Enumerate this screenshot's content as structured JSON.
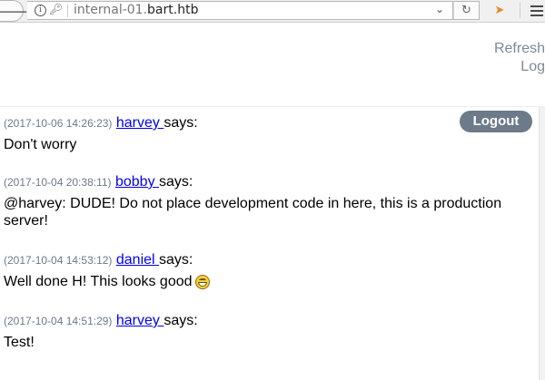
{
  "browser": {
    "back_icon": "arrow-left-icon",
    "info_icon": "info-icon",
    "key_icon": "key-icon",
    "url_host": "internal-01.",
    "url_domain": "bart.htb",
    "dropdown_icon": "chevron-down-icon",
    "reload_icon": "reload-icon",
    "extension_icon": "extension-icon",
    "menu_icon": "hamburger-menu-icon"
  },
  "page": {
    "links": [
      "Refresh",
      "Log"
    ],
    "logout_label": "Logout",
    "accent_color": "#6c7a89"
  },
  "messages": [
    {
      "timestamp": "(2017-10-06 14:26:23)",
      "user": "harvey ",
      "says": "says:",
      "text": "Don't worry"
    },
    {
      "timestamp": "(2017-10-04 20:38:11)",
      "user": "bobby ",
      "says": "says:",
      "text": "@harvey: DUDE! Do not place development code in here, this is a production server!"
    },
    {
      "timestamp": "(2017-10-04 14:53:12)",
      "user": "daniel ",
      "says": "says:",
      "text": "Well done H! This looks good",
      "emoji": "grinning-face-icon"
    },
    {
      "timestamp": "(2017-10-04 14:51:29)",
      "user": "harvey ",
      "says": "says:",
      "text": "Test!"
    }
  ]
}
